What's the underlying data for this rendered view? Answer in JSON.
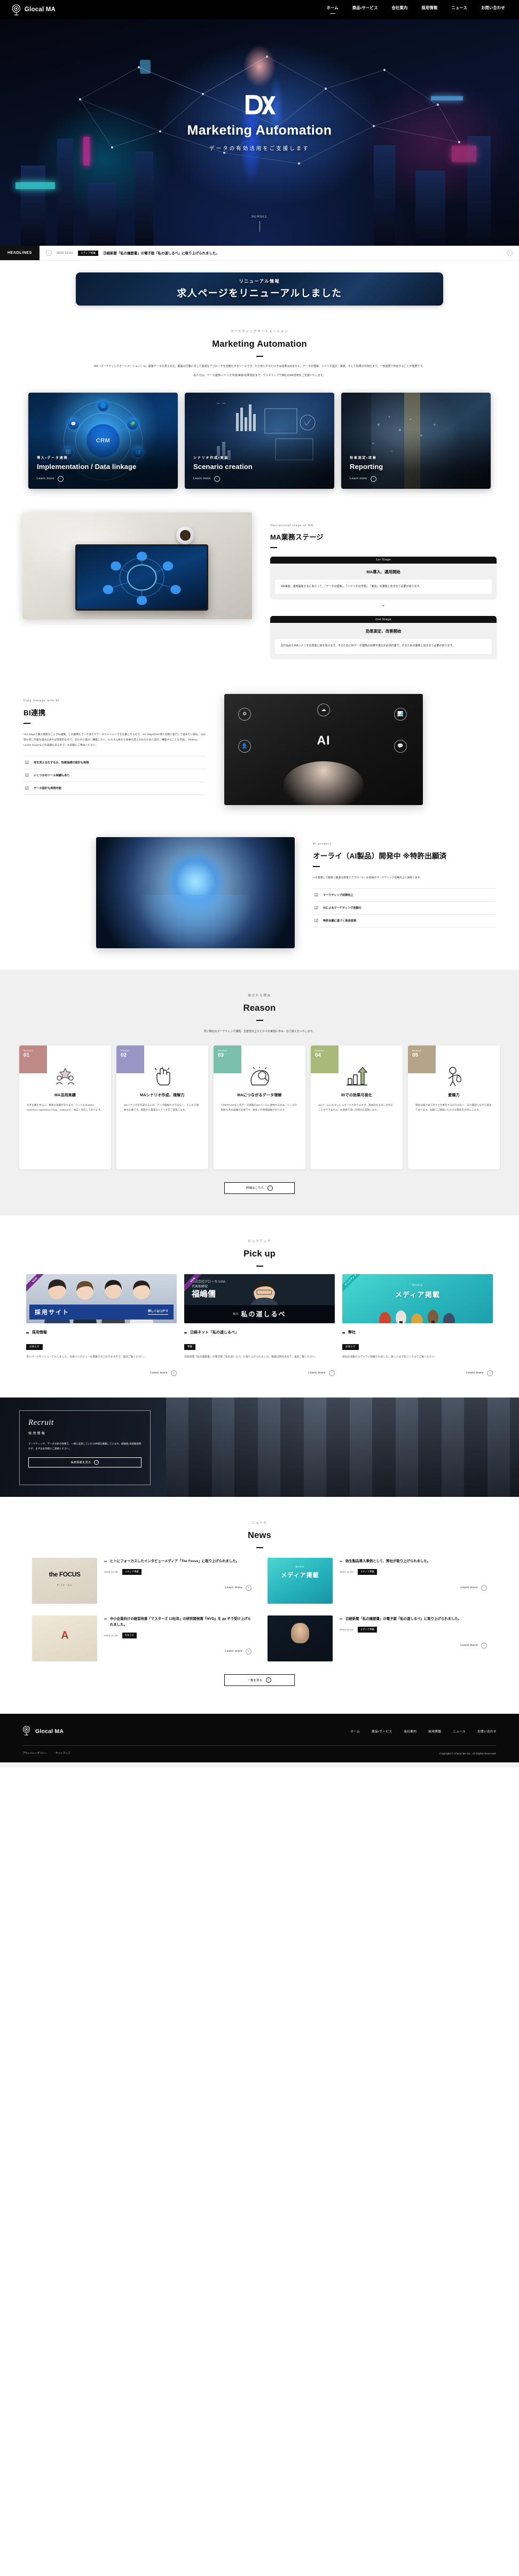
{
  "header": {
    "brand": "Glocal MA",
    "nav": [
      {
        "label": "ホーム",
        "active": true
      },
      {
        "label": "商品・サービス",
        "active": false
      },
      {
        "label": "会社案内",
        "active": false
      },
      {
        "label": "採用情報",
        "active": false
      },
      {
        "label": "ニュース",
        "active": false
      },
      {
        "label": "お問い合わせ",
        "active": false
      }
    ]
  },
  "hero": {
    "logo_text": "DX",
    "title": "Marketing Automation",
    "subtitle": "データの有効活用をご支援します",
    "scroll_label": "SCROLL"
  },
  "headlines": {
    "tag": "HEADLINES",
    "prev_icon": "chevron-left-icon",
    "next_icon": "chevron-right-icon",
    "date": "2022.12.01",
    "badge": "メディア掲載",
    "text": "日経新聞「私の履歴書」の電子版「私の道しるべ」に取り上げられました。"
  },
  "renewal_banner": {
    "kicker": "リニューアル情報",
    "title": "求人ページをリニューアルしました"
  },
  "ma_section": {
    "kicker": "マーケティングオートメーション",
    "title": "Marketing Automation",
    "lede": [
      "MA（マーケティングオートメーション）は、顧客データの見える化、顧客の行動に対して最適なアプローチを自動化するツールです。ただ導入するだけでは成果は出ません。データの理解、シナリオ設計、実装、そして効果の可視化まで、一気通貫で伴走することが重要です。",
      "私たちは、データ連携・シナリオ作成・実装・効果測定まで、ワンストップで御社のMA活用をご支援いたします。"
    ],
    "cards": [
      {
        "jp": "導入・データ連携",
        "en": "Implementation / Data linkage",
        "learn": "Learn more"
      },
      {
        "jp": "シナリオ作成・実装",
        "en": "Scenario creation",
        "learn": "Learn more"
      },
      {
        "jp": "効果測定・改善",
        "en": "Reporting",
        "learn": "Learn more"
      }
    ]
  },
  "stage_section": {
    "kicker": "Operational stage of MA",
    "title": "MA業務ステージ",
    "stages": [
      {
        "label": "1st Stage",
        "title": "MA導入、運用開始",
        "body": "MA実装、運用開始するにあたって、「データの理解」、「シナリオの作成」、「実装」の課題と向き合う必要があります。"
      },
      {
        "label": "2nd Stage",
        "title": "効果測定、改善開始",
        "body": "回り始めたMAシナリオの改善に目を向けます。そのためにBIデータ連携の効果可視化が必須作業で、そのための課題と向き合う必要があります。"
      }
    ]
  },
  "bi_section": {
    "kicker": "Data linkage with BI",
    "title": "BI連携",
    "body": "2nd Stageで最も重要なことがBI連携。この業務もデータ加工やデータクレンジングを必要とするので、1st StageのMA導入の際に並行して進めたい部分。SQL等も同じ内容を組み込めれば効率的なので、忘れずに設計、構築したい。もちろん後から効果の見える化のために設計、構築することも可能。\nTableau、Locker Studioなどの実績もあるので、お気軽にご用命ください。",
    "checks": [
      "何を見える化するか、効果指標の設計も実現",
      "いくつかのツール実績もあり",
      "データ設計も実現可能"
    ]
  },
  "ai_section": {
    "kicker": "AI product",
    "title": "オーライ（AI製品）開発中 ※特許出願済",
    "body": "AIを駆使して顧客に最適な施策でアプローチ。お客様のマーケティング成果向上に貢献します。",
    "checks": [
      "マーケティング成果向上",
      "AIによるマーケティング自動化",
      "特許出願に基づく独自技術"
    ]
  },
  "reason_section": {
    "kicker": "選ばれる理由",
    "title": "Reason",
    "lede": "共に御社のマーケティング課題、生産性向上などＤＸの実現に歩み、お力添えをいたします。",
    "cards": [
      {
        "label": "Reason",
        "num": "01",
        "color": "#bf8a86",
        "icon": "team-star-icon",
        "title": "MA活用実績",
        "text": "大手企業を中心に、豊富な実績があります。ツールもMarketo、Salesforce Marketing Cloud、Adobeなど、幅広く対応しております。"
      },
      {
        "label": "Reason",
        "num": "02",
        "color": "#9a95c4",
        "icon": "click-hand-icon",
        "title": "MAシナリオ作成、理解力",
        "text": "MAシナリオを作成するには、データ理解だけではなく、ビジネス理解も必要です。両面から最適なシナリオをご提案します。"
      },
      {
        "label": "Reason",
        "num": "03",
        "color": "#7bc0ab",
        "icon": "head-idea-icon",
        "title": "MAにつながるデータ理解",
        "text": "CRMやCDPなどのデータ基盤をMAツールに連携するのは、ツールの制約も含め経験が必要です。数多くの現場経験があります。"
      },
      {
        "label": "Reason",
        "num": "04",
        "color": "#a9b97a",
        "icon": "bar-growth-icon",
        "title": "BIでの効果可視化",
        "text": "MAツールにもダッシュボードがありますが、基本的なものしか見ることができません。BI連携で深い可視化を実現します。"
      },
      {
        "label": "Reason",
        "num": "05",
        "color": "#b5a488",
        "icon": "friendly-person-icon",
        "title": "愛嬌力",
        "text": "弊社は受け身で次々と仕事をやるのではなく、日々確認しながら進めております。気軽にご相談いただける関係を大切にします。"
      }
    ],
    "button": "詳細はこちら",
    "button_icon": "chevron-right-icon"
  },
  "pickup_section": {
    "kicker": "ピックアップ",
    "title": "Pick up",
    "cards": [
      {
        "flag": "NEW",
        "thumb_kind": "recruit",
        "thumb_title": "採用サイト",
        "thumb_cta": "詳しくはコチラ",
        "title": "採用情報",
        "badge": "お知らせ",
        "text": "求人ページをリニューアルしました。社員インタビューも掲載されておりますので、是非ご覧ください。",
        "learn": "Learn more"
      },
      {
        "flag": "NEW",
        "thumb_kind": "nikkei",
        "thumb_title": "私の道しるべ",
        "thumb_sub": "株式会社グローカルMA 代表取締役 福嶋儒",
        "title": "日経ネット「私の道しるべ」",
        "badge": "特集",
        "text": "日経新聞「私の履歴書」の電子版「私の道しるべ」に取り上げられました。動画は弊社本社で、是非ご覧ください。",
        "learn": "Learn more"
      },
      {
        "flag": "ピックアップ",
        "thumb_kind": "media",
        "thumb_kicker": "Media",
        "thumb_title": "メディア掲載",
        "title": "弊社",
        "badge": "お知らせ",
        "text": "弊社の活動がメディアに掲載されました。詳しくは下記リンクよりご覧ください。",
        "learn": "Learn more"
      }
    ]
  },
  "recruit_banner": {
    "script": "Recruit",
    "jp": "採用情報",
    "text": "マーケティング、データ分析の現場で、一緒に成長していける仲間を募集しています。経験者・未経験者問わず、まずはお気軽にご連絡ください。",
    "button": "採用情報を見る",
    "button_icon": "chevron-right-icon"
  },
  "news_section": {
    "kicker": "ニュース",
    "title": "News",
    "items": [
      {
        "thumb": "the-focus-logo",
        "thumb_text": "the FOCUS",
        "thumb_sub": "ザ・フォーカス",
        "title": "ヒトにフォーカスしたインタビューメディア「The Focus」に取り上げられました。",
        "date": "2022.12.08",
        "badge": "メディア掲載",
        "learn": "Learn more"
      },
      {
        "thumb": "media-teal",
        "thumb_kicker": "Media",
        "thumb_text": "メディア掲載",
        "title": "弥生製品導入事例として、弊社が取り上げられました。",
        "date": "2022.12.02",
        "badge": "メディア掲載",
        "learn": "Learn more"
      },
      {
        "thumb": "award-poster",
        "thumb_text": "A",
        "title": "中小企業向けの経営改善「マスターズ 13社年」の研究開発賞『MVD』を да ぞう受け上げられました。",
        "date": "2022.11.25",
        "badge": "お知らせ",
        "learn": "Learn more"
      },
      {
        "thumb": "person-dark",
        "title": "日経新聞「私の履歴書」の電子版「私の道しるべ」に取り上げられました。",
        "date": "2022.12.01",
        "badge": "メディア掲載",
        "learn": "Learn more"
      }
    ],
    "button": "一覧を見る",
    "button_icon": "chevron-right-icon"
  },
  "footer": {
    "brand": "Glocal MA",
    "nav": [
      "ホーム",
      "商品・サービス",
      "会社案内",
      "採用情報",
      "ニュース",
      "お問い合わせ"
    ],
    "links": [
      "プライバシーポリシー",
      "サイトマップ"
    ],
    "copyright": "Copyright © Glocal MA Inc. All Rights Reserved."
  }
}
